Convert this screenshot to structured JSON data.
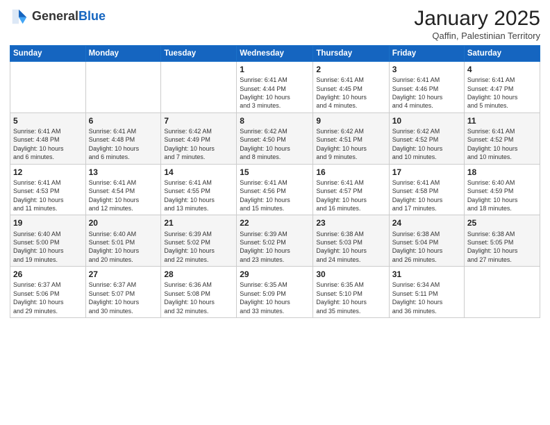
{
  "header": {
    "logo_general": "General",
    "logo_blue": "Blue",
    "month_title": "January 2025",
    "subtitle": "Qaffin, Palestinian Territory"
  },
  "days_of_week": [
    "Sunday",
    "Monday",
    "Tuesday",
    "Wednesday",
    "Thursday",
    "Friday",
    "Saturday"
  ],
  "weeks": [
    [
      {
        "num": "",
        "info": ""
      },
      {
        "num": "",
        "info": ""
      },
      {
        "num": "",
        "info": ""
      },
      {
        "num": "1",
        "info": "Sunrise: 6:41 AM\nSunset: 4:44 PM\nDaylight: 10 hours\nand 3 minutes."
      },
      {
        "num": "2",
        "info": "Sunrise: 6:41 AM\nSunset: 4:45 PM\nDaylight: 10 hours\nand 4 minutes."
      },
      {
        "num": "3",
        "info": "Sunrise: 6:41 AM\nSunset: 4:46 PM\nDaylight: 10 hours\nand 4 minutes."
      },
      {
        "num": "4",
        "info": "Sunrise: 6:41 AM\nSunset: 4:47 PM\nDaylight: 10 hours\nand 5 minutes."
      }
    ],
    [
      {
        "num": "5",
        "info": "Sunrise: 6:41 AM\nSunset: 4:48 PM\nDaylight: 10 hours\nand 6 minutes."
      },
      {
        "num": "6",
        "info": "Sunrise: 6:41 AM\nSunset: 4:48 PM\nDaylight: 10 hours\nand 6 minutes."
      },
      {
        "num": "7",
        "info": "Sunrise: 6:42 AM\nSunset: 4:49 PM\nDaylight: 10 hours\nand 7 minutes."
      },
      {
        "num": "8",
        "info": "Sunrise: 6:42 AM\nSunset: 4:50 PM\nDaylight: 10 hours\nand 8 minutes."
      },
      {
        "num": "9",
        "info": "Sunrise: 6:42 AM\nSunset: 4:51 PM\nDaylight: 10 hours\nand 9 minutes."
      },
      {
        "num": "10",
        "info": "Sunrise: 6:42 AM\nSunset: 4:52 PM\nDaylight: 10 hours\nand 10 minutes."
      },
      {
        "num": "11",
        "info": "Sunrise: 6:41 AM\nSunset: 4:52 PM\nDaylight: 10 hours\nand 10 minutes."
      }
    ],
    [
      {
        "num": "12",
        "info": "Sunrise: 6:41 AM\nSunset: 4:53 PM\nDaylight: 10 hours\nand 11 minutes."
      },
      {
        "num": "13",
        "info": "Sunrise: 6:41 AM\nSunset: 4:54 PM\nDaylight: 10 hours\nand 12 minutes."
      },
      {
        "num": "14",
        "info": "Sunrise: 6:41 AM\nSunset: 4:55 PM\nDaylight: 10 hours\nand 13 minutes."
      },
      {
        "num": "15",
        "info": "Sunrise: 6:41 AM\nSunset: 4:56 PM\nDaylight: 10 hours\nand 15 minutes."
      },
      {
        "num": "16",
        "info": "Sunrise: 6:41 AM\nSunset: 4:57 PM\nDaylight: 10 hours\nand 16 minutes."
      },
      {
        "num": "17",
        "info": "Sunrise: 6:41 AM\nSunset: 4:58 PM\nDaylight: 10 hours\nand 17 minutes."
      },
      {
        "num": "18",
        "info": "Sunrise: 6:40 AM\nSunset: 4:59 PM\nDaylight: 10 hours\nand 18 minutes."
      }
    ],
    [
      {
        "num": "19",
        "info": "Sunrise: 6:40 AM\nSunset: 5:00 PM\nDaylight: 10 hours\nand 19 minutes."
      },
      {
        "num": "20",
        "info": "Sunrise: 6:40 AM\nSunset: 5:01 PM\nDaylight: 10 hours\nand 20 minutes."
      },
      {
        "num": "21",
        "info": "Sunrise: 6:39 AM\nSunset: 5:02 PM\nDaylight: 10 hours\nand 22 minutes."
      },
      {
        "num": "22",
        "info": "Sunrise: 6:39 AM\nSunset: 5:02 PM\nDaylight: 10 hours\nand 23 minutes."
      },
      {
        "num": "23",
        "info": "Sunrise: 6:38 AM\nSunset: 5:03 PM\nDaylight: 10 hours\nand 24 minutes."
      },
      {
        "num": "24",
        "info": "Sunrise: 6:38 AM\nSunset: 5:04 PM\nDaylight: 10 hours\nand 26 minutes."
      },
      {
        "num": "25",
        "info": "Sunrise: 6:38 AM\nSunset: 5:05 PM\nDaylight: 10 hours\nand 27 minutes."
      }
    ],
    [
      {
        "num": "26",
        "info": "Sunrise: 6:37 AM\nSunset: 5:06 PM\nDaylight: 10 hours\nand 29 minutes."
      },
      {
        "num": "27",
        "info": "Sunrise: 6:37 AM\nSunset: 5:07 PM\nDaylight: 10 hours\nand 30 minutes."
      },
      {
        "num": "28",
        "info": "Sunrise: 6:36 AM\nSunset: 5:08 PM\nDaylight: 10 hours\nand 32 minutes."
      },
      {
        "num": "29",
        "info": "Sunrise: 6:35 AM\nSunset: 5:09 PM\nDaylight: 10 hours\nand 33 minutes."
      },
      {
        "num": "30",
        "info": "Sunrise: 6:35 AM\nSunset: 5:10 PM\nDaylight: 10 hours\nand 35 minutes."
      },
      {
        "num": "31",
        "info": "Sunrise: 6:34 AM\nSunset: 5:11 PM\nDaylight: 10 hours\nand 36 minutes."
      },
      {
        "num": "",
        "info": ""
      }
    ]
  ]
}
